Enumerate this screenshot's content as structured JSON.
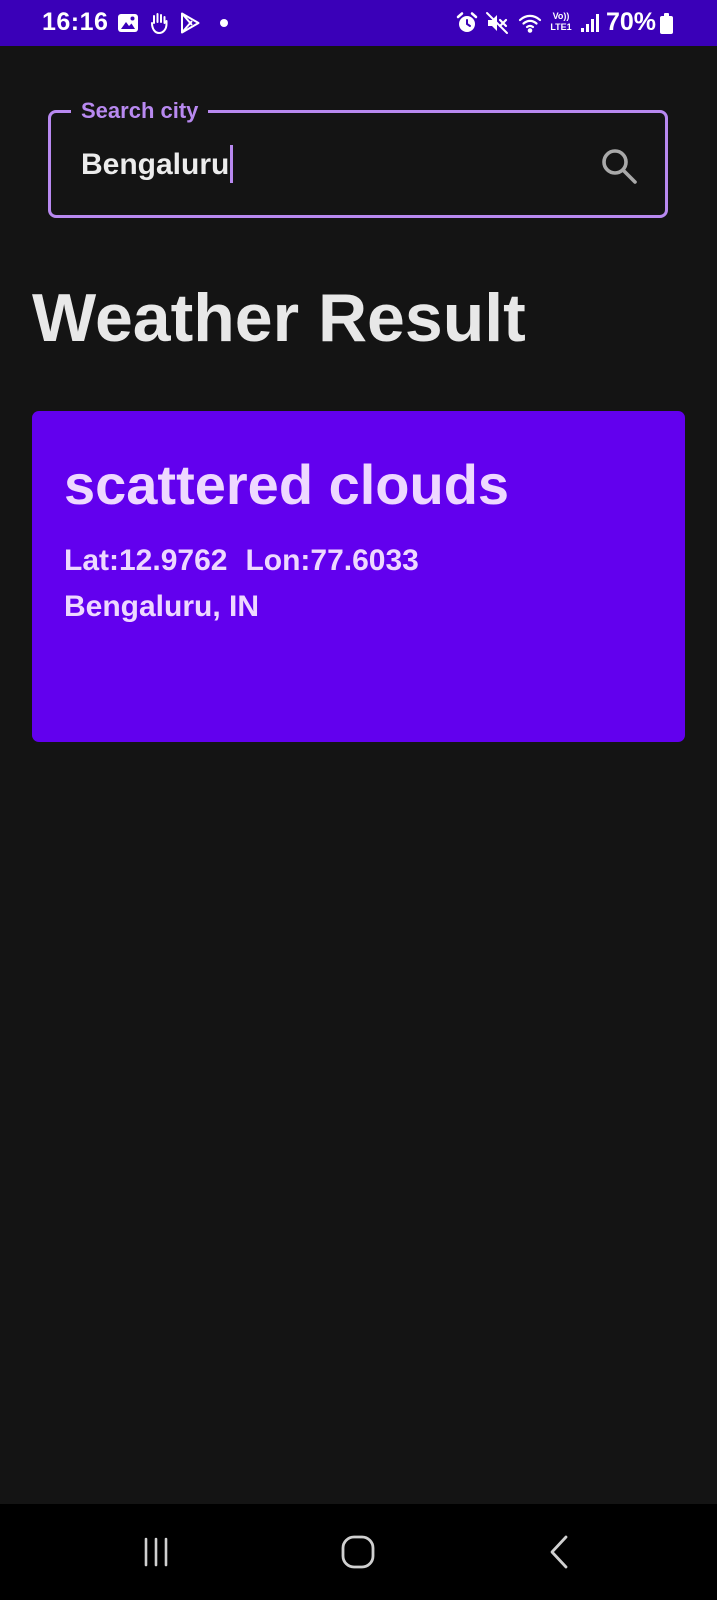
{
  "status_bar": {
    "time": "16:16",
    "network_label_top": "Vo))",
    "network_label_bottom": "LTE1",
    "battery": "70%"
  },
  "search": {
    "label": "Search city",
    "value": "Bengaluru"
  },
  "page": {
    "title": "Weather Result"
  },
  "result": {
    "description": "scattered clouds",
    "lat": "Lat:12.9762",
    "lon": "Lon:77.6033",
    "location": "Bengaluru, IN"
  },
  "colors": {
    "status_bar": "#3a00b8",
    "accent_outline": "#b889f0",
    "card": "#6200ee",
    "card_text": "#eed8ff",
    "background": "#141414"
  },
  "icons": {
    "status": [
      "gallery-icon",
      "hand-icon",
      "play-store-icon",
      "alarm-icon",
      "mute-icon",
      "wifi-icon",
      "signal-icon",
      "battery-icon"
    ],
    "search": "search-icon",
    "navigation": [
      "recents-icon",
      "home-icon",
      "back-icon"
    ]
  }
}
